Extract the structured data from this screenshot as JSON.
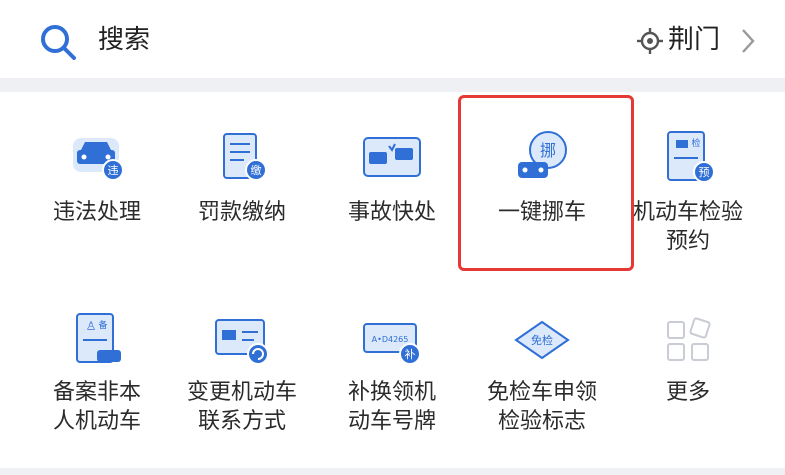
{
  "search": {
    "label": "搜索",
    "icon": "search-icon"
  },
  "location": {
    "label": "荆门",
    "icon": "locate-icon"
  },
  "colors": {
    "primary": "#2f6fd6",
    "accent": "#e53935",
    "icon_light": "#dce9fb"
  },
  "services": [
    {
      "label": "违法处理",
      "icon": "car-violation-icon",
      "badge": "违"
    },
    {
      "label": "罚款缴纳",
      "icon": "fine-payment-icon",
      "badge": "缴"
    },
    {
      "label": "事故快处",
      "icon": "accident-icon"
    },
    {
      "label": "一键挪车",
      "icon": "move-car-icon",
      "badge": "挪"
    },
    {
      "label": "机动车检验预约",
      "icon": "inspection-booking-icon",
      "badge": "预",
      "tag": "检"
    },
    {
      "label": "备案非本人机动车",
      "icon": "registration-icon",
      "badge": "备"
    },
    {
      "label": "变更机动车联系方式",
      "icon": "contact-change-icon"
    },
    {
      "label": "补换领机动车号牌",
      "icon": "plate-replace-icon",
      "badge": "补",
      "plate": "A•D4265"
    },
    {
      "label": "免检车申领检验标志",
      "icon": "exempt-icon",
      "badge": "免检"
    },
    {
      "label": "更多",
      "icon": "more-icon"
    }
  ]
}
